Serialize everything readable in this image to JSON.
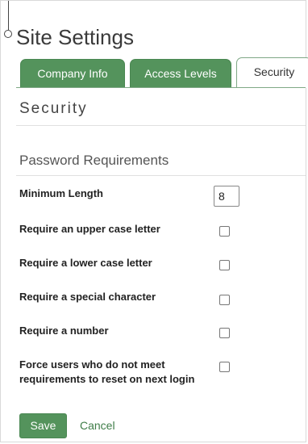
{
  "page": {
    "title": "Site Settings"
  },
  "tabs": [
    {
      "label": "Company Info",
      "active": false
    },
    {
      "label": "Access Levels",
      "active": false
    },
    {
      "label": "Security",
      "active": true
    }
  ],
  "section": {
    "title": "Security"
  },
  "password_requirements": {
    "title": "Password Requirements",
    "minimum_length": {
      "label": "Minimum Length",
      "value": "8"
    },
    "options": [
      {
        "label": "Require an upper case letter",
        "checked": false
      },
      {
        "label": "Require a lower case letter",
        "checked": false
      },
      {
        "label": "Require a special character",
        "checked": false
      },
      {
        "label": "Require a number",
        "checked": false
      },
      {
        "label": "Force users who do not meet requirements to reset on next login",
        "checked": false
      }
    ]
  },
  "actions": {
    "save_label": "Save",
    "cancel_label": "Cancel"
  },
  "colors": {
    "accent_green": "#54935c",
    "link_green": "#3f7d48"
  }
}
